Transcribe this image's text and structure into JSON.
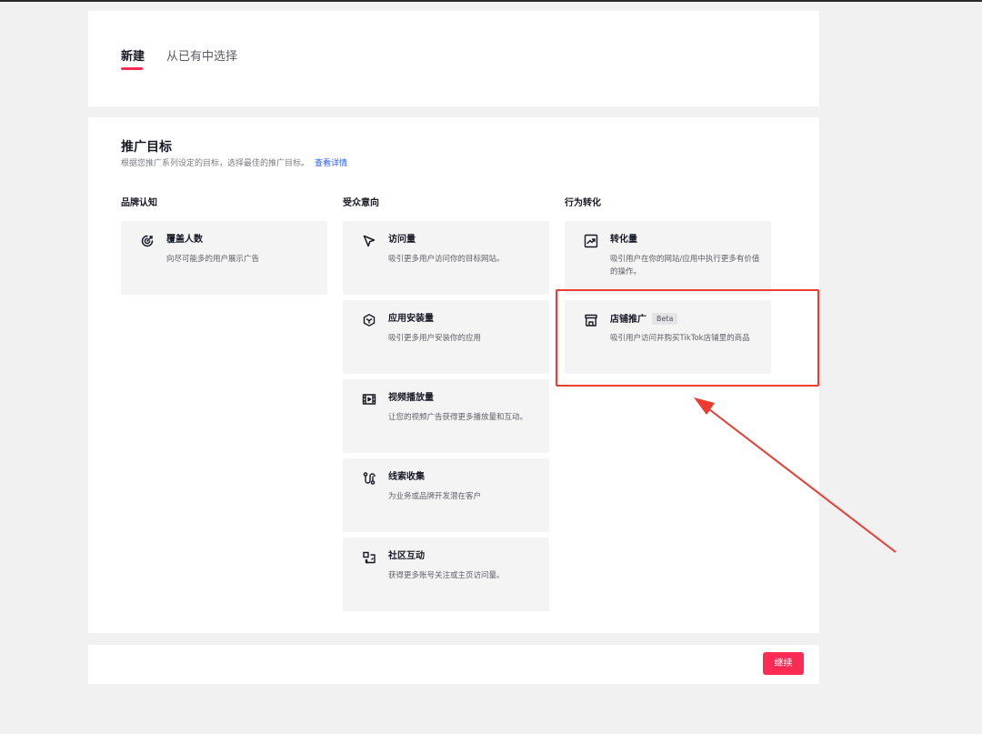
{
  "tabs": {
    "new_label": "新建",
    "existing_label": "从已有中选择"
  },
  "objective": {
    "title": "推广目标",
    "subtitle": "根据您推广系列设定的目标，选择最佳的推广目标。",
    "link": "查看详情"
  },
  "columns": [
    {
      "title": "品牌认知",
      "cards": [
        {
          "icon": "target-icon",
          "title": "覆盖人数",
          "desc": "向尽可能多的用户展示广告"
        }
      ]
    },
    {
      "title": "受众意向",
      "cards": [
        {
          "icon": "cursor-icon",
          "title": "访问量",
          "desc": "吸引更多用户访问你的目标网站。"
        },
        {
          "icon": "cube-icon",
          "title": "应用安装量",
          "desc": "吸引更多用户安装你的应用"
        },
        {
          "icon": "video-icon",
          "title": "视频播放量",
          "desc": "让您的视频广告获得更多播放量和互动。"
        },
        {
          "icon": "lead-icon",
          "title": "线索收集",
          "desc": "为业务或品牌开发潜在客户"
        },
        {
          "icon": "community-icon",
          "title": "社区互动",
          "desc": "获得更多账号关注或主页访问量。"
        }
      ]
    },
    {
      "title": "行为转化",
      "cards": [
        {
          "icon": "trend-icon",
          "title": "转化量",
          "desc": "吸引用户在你的网站/应用中执行更多有价值的操作。"
        },
        {
          "icon": "shop-icon",
          "title": "店铺推广",
          "badge": "Beta",
          "desc": "吸引用户访问并购买TikTok店铺里的商品"
        }
      ]
    }
  ],
  "footer": {
    "continue_label": "继续"
  },
  "colors": {
    "accent": "#fe2c55",
    "link": "#2b5de8",
    "annotation": "#ee3b2f"
  }
}
